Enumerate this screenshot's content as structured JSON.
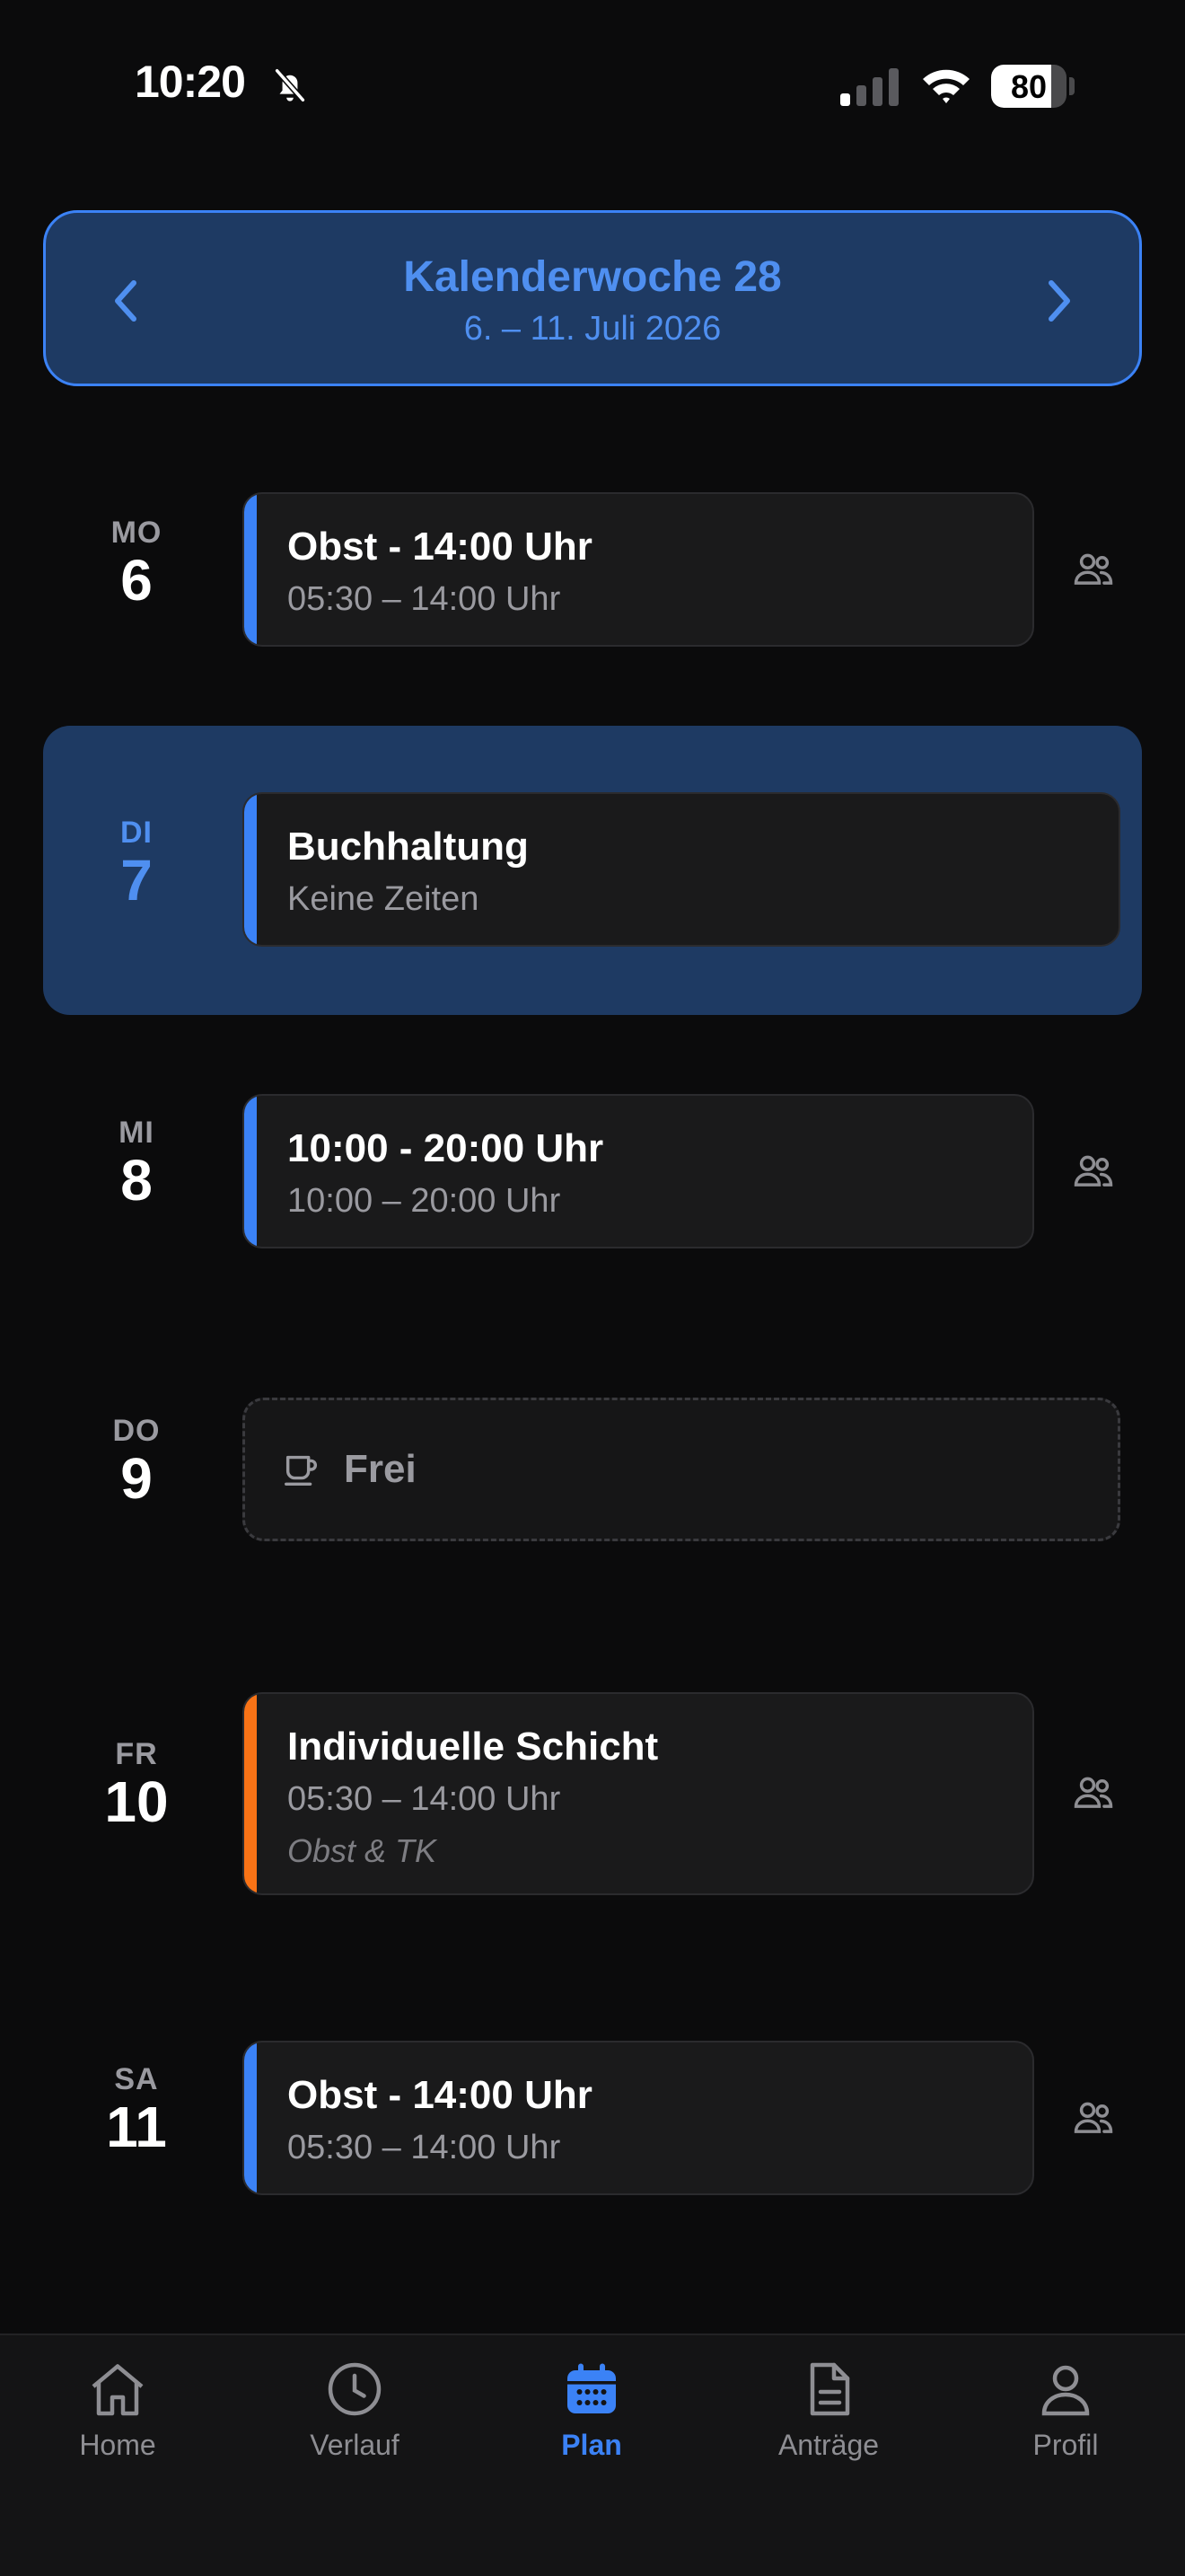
{
  "status_bar": {
    "time": "10:20",
    "battery_level": 80,
    "battery_label": "80"
  },
  "week_header": {
    "title": "Kalenderwoche 28",
    "range": "6. – 11. Juli 2026",
    "prev_icon": "chevron-left-icon",
    "next_icon": "chevron-right-icon"
  },
  "days": [
    {
      "abbr": "MO",
      "num": "6",
      "title": "Obst - 14:00 Uhr",
      "time": "05:30 – 14:00 Uhr",
      "accent": "#3b82f6"
    },
    {
      "abbr": "DI",
      "num": "7",
      "title": "Buchhaltung",
      "time": "Keine Zeiten",
      "accent": "#3b82f6",
      "today": true
    },
    {
      "abbr": "MI",
      "num": "8",
      "title": "10:00 - 20:00 Uhr",
      "time": "10:00 – 20:00 Uhr",
      "accent": "#3b82f6"
    },
    {
      "abbr": "DO",
      "num": "9",
      "free_label": "Frei"
    },
    {
      "abbr": "FR",
      "num": "10",
      "title": "Individuelle Schicht",
      "time": "05:30 – 14:00 Uhr",
      "note": "Obst & TK",
      "accent": "#f97316"
    },
    {
      "abbr": "SA",
      "num": "11",
      "title": "Obst - 14:00 Uhr",
      "time": "05:30 – 14:00 Uhr",
      "accent": "#3b82f6"
    }
  ],
  "tab_bar": {
    "tabs": [
      {
        "label": "Home",
        "icon": "home-icon"
      },
      {
        "label": "Verlauf",
        "icon": "clock-icon"
      },
      {
        "label": "Plan",
        "icon": "calendar-icon",
        "active": true
      },
      {
        "label": "Anträge",
        "icon": "document-icon"
      },
      {
        "label": "Profil",
        "icon": "person-icon"
      }
    ]
  },
  "colors": {
    "accent_blue": "#3b82f6",
    "accent_orange": "#f97316",
    "highlight_bg": "#1e3a63"
  }
}
